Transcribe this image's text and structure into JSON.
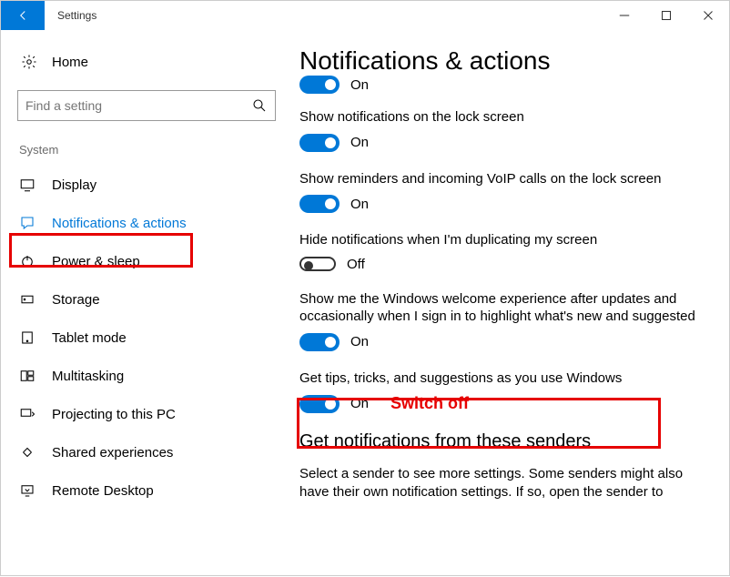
{
  "window": {
    "title": "Settings"
  },
  "sidebar": {
    "home": "Home",
    "search_placeholder": "Find a setting",
    "section": "System",
    "items": [
      {
        "label": "Display"
      },
      {
        "label": "Notifications & actions"
      },
      {
        "label": "Power & sleep"
      },
      {
        "label": "Storage"
      },
      {
        "label": "Tablet mode"
      },
      {
        "label": "Multitasking"
      },
      {
        "label": "Projecting to this PC"
      },
      {
        "label": "Shared experiences"
      },
      {
        "label": "Remote Desktop"
      }
    ]
  },
  "main": {
    "heading": "Notifications & actions",
    "partial_state": "On",
    "settings": [
      {
        "desc": "Show notifications on the lock screen",
        "state": "On",
        "on": true
      },
      {
        "desc": "Show reminders and incoming VoIP calls on the lock screen",
        "state": "On",
        "on": true
      },
      {
        "desc": "Hide notifications when I'm duplicating my screen",
        "state": "Off",
        "on": false
      },
      {
        "desc": "Show me the Windows welcome experience after updates and occasionally when I sign in to highlight what's new and suggested",
        "state": "On",
        "on": true
      },
      {
        "desc": "Get tips, tricks, and suggestions as you use Windows",
        "state": "On",
        "on": true
      }
    ],
    "senders_heading": "Get notifications from these senders",
    "senders_desc": "Select a sender to see more settings. Some senders might also have their own notification settings. If so, open the sender to"
  },
  "annotation": {
    "switch_off": "Switch off"
  }
}
